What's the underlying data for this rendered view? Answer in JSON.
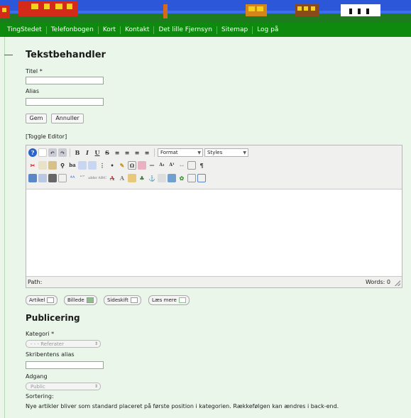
{
  "nav": {
    "items": [
      "TingStedet",
      "Telefonbogen",
      "Kort",
      "Kontakt",
      "Det lille Fjernsyn",
      "Sitemap",
      "Log på"
    ]
  },
  "form": {
    "heading": "Tekstbehandler",
    "title_label": "Titel *",
    "title_value": "",
    "alias_label": "Alias",
    "alias_value": "",
    "save_label": "Gem",
    "cancel_label": "Annuller",
    "toggle_editor": "[Toggle Editor]"
  },
  "editor": {
    "format_select": "Format",
    "styles_select": "Styles",
    "path_label": "Path:",
    "word_count": "Words: 0",
    "content": ""
  },
  "editor_buttons": {
    "article": "Artikel",
    "image": "Billede",
    "pagebreak": "Sideskift",
    "readmore": "Læs mere"
  },
  "publishing": {
    "heading": "Publicering",
    "category_label": "Kategori *",
    "category_value": "- - - Referater",
    "author_alias_label": "Skribentens alias",
    "author_alias_value": "",
    "access_label": "Adgang",
    "access_value": "Public",
    "ordering_label": "Sortering:",
    "ordering_note": "Nye artikler bliver som standard placeret på første position i kategorien. Rækkefølgen kan ændres i back-end."
  },
  "colors": {
    "nav_bg": "#0e8a0e",
    "content_bg": "#e9f6e9",
    "banner_sky": "#2b57d8"
  }
}
